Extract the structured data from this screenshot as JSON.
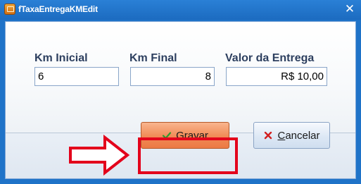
{
  "window": {
    "title": "fTaxaEntregaKMEdit",
    "close_symbol": "✕"
  },
  "fields": {
    "km_inicial": {
      "label": "Km Inicial",
      "value": "6"
    },
    "km_final": {
      "label": "Km Final",
      "value": "8"
    },
    "valor_entrega": {
      "label": "Valor da Entrega",
      "value": "R$ 10,00"
    }
  },
  "buttons": {
    "gravar": {
      "label": "Gravar",
      "icon": "check-icon",
      "accent": "#f08a55"
    },
    "cancelar": {
      "label": "Cancelar",
      "icon": "x-icon"
    }
  },
  "annotation": {
    "highlight_color": "#e3001b",
    "arrow_icon": "right-arrow-icon"
  }
}
